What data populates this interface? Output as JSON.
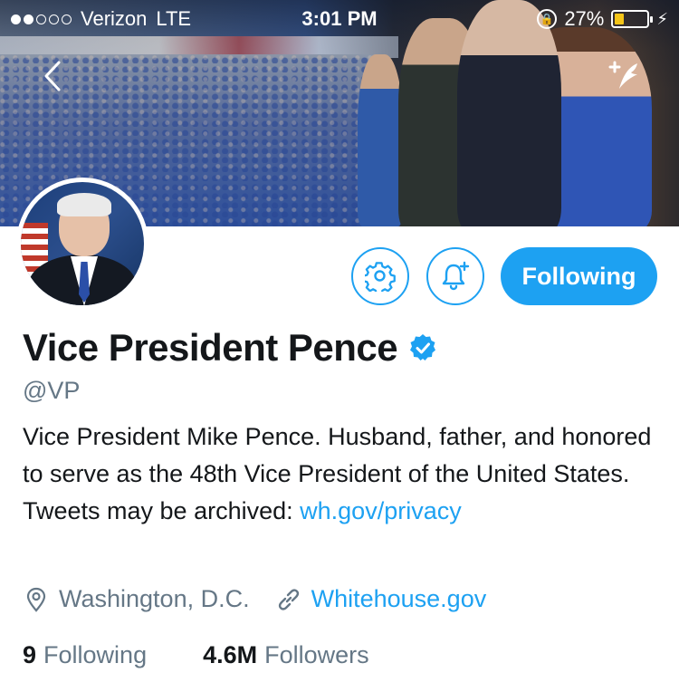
{
  "status_bar": {
    "carrier": "Verizon",
    "network": "LTE",
    "time": "3:01 PM",
    "battery_percent": "27%",
    "battery_level": 0.27,
    "signal_bars_filled": 2,
    "signal_bars_total": 5
  },
  "header": {
    "back_icon": "chevron-left-icon",
    "compose_icon": "compose-tweet-icon"
  },
  "actions": {
    "settings_icon": "gear-icon",
    "notify_icon": "bell-plus-icon",
    "follow_label": "Following"
  },
  "profile": {
    "display_name": "Vice President Pence",
    "verified": true,
    "handle": "@VP",
    "bio_text": "Vice President Mike Pence. Husband, father, and honored to serve as the 48th Vice President of the United States. Tweets may be archived: ",
    "bio_link": "wh.gov/privacy",
    "location": "Washington, D.C.",
    "website": "Whitehouse.gov",
    "following_count": "9",
    "following_label": "Following",
    "followers_count": "4.6M",
    "followers_label": "Followers"
  },
  "colors": {
    "accent": "#1da1f2",
    "text": "#14171a",
    "secondary": "#657786",
    "battery": "#f5c518"
  }
}
